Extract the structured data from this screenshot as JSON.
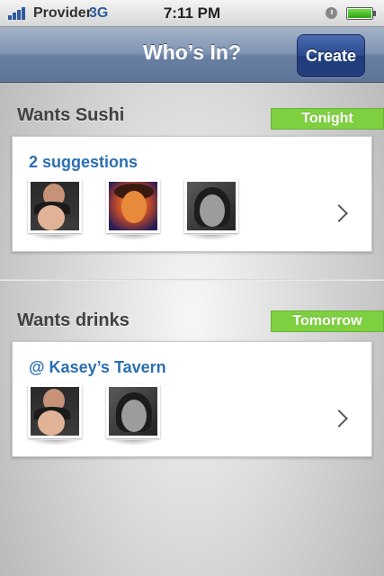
{
  "status_bar": {
    "carrier": "Provider",
    "network": "3G",
    "time": "7:11 PM"
  },
  "nav": {
    "title": "Who’s In?",
    "create_label": "Create"
  },
  "sections": [
    {
      "title": "Wants Sushi",
      "when": "Tonight",
      "heading": "2 suggestions",
      "avatars": [
        "couple-photo",
        "painted-portrait-photo",
        "bw-portrait-photo"
      ]
    },
    {
      "title": "Wants drinks",
      "when": "Tomorrow",
      "heading": "@ Kasey’s Tavern",
      "avatars": [
        "couple-photo",
        "bw-portrait-photo"
      ]
    }
  ],
  "colors": {
    "badge_green": "#7ed040",
    "link_blue": "#2a6eb3",
    "nav_blue": "#6a80a3"
  }
}
